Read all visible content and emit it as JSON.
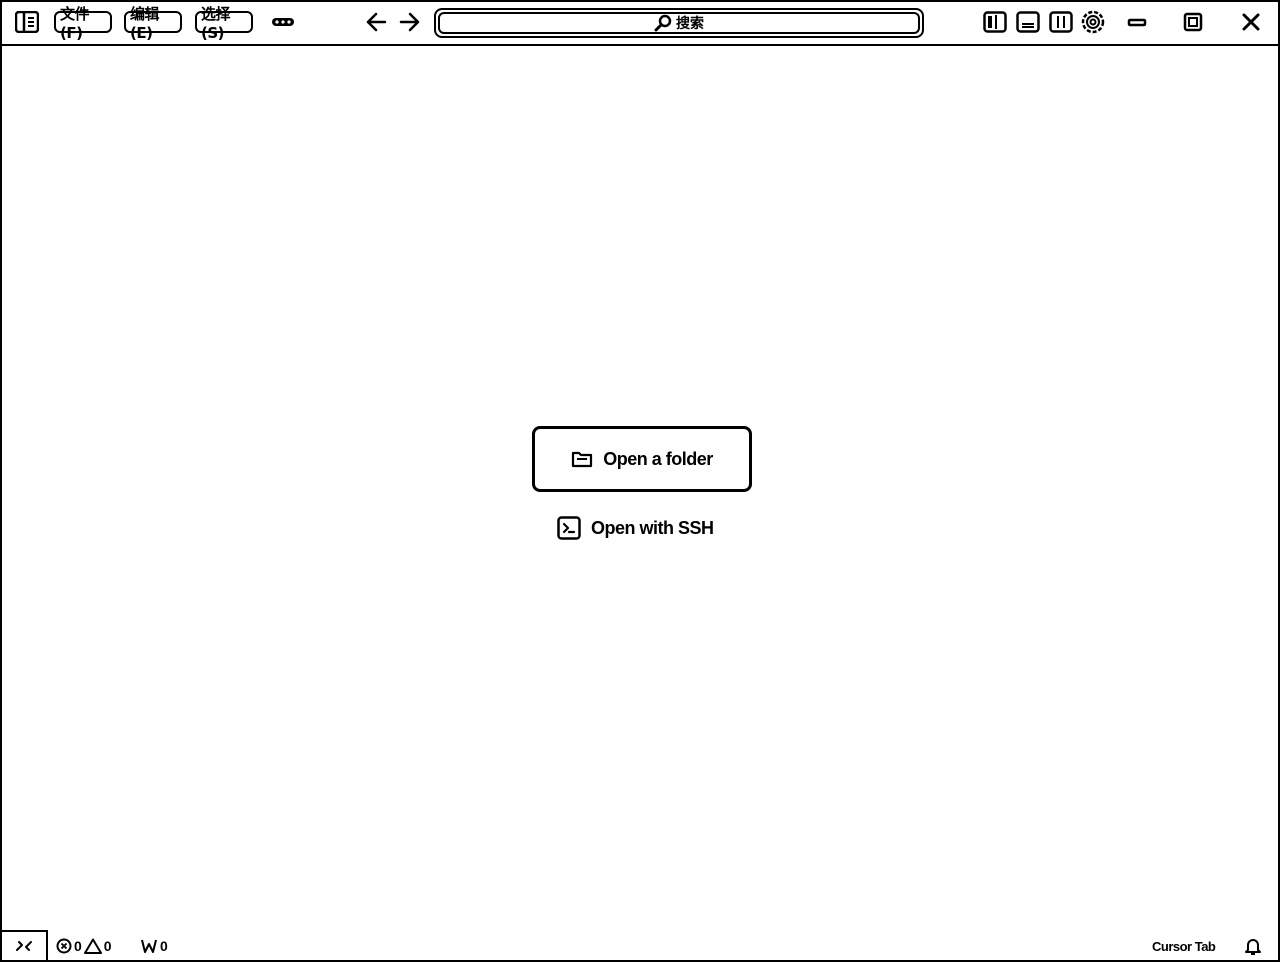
{
  "titlebar": {
    "menus": [
      {
        "label": "文件(F)"
      },
      {
        "label": "编辑(E)"
      },
      {
        "label": "选择(S)"
      }
    ],
    "more_label": "•••",
    "search_placeholder": "搜索"
  },
  "main": {
    "open_folder_label": "Open a folder",
    "open_ssh_label": "Open with SSH"
  },
  "statusbar": {
    "errors": "0",
    "warnings": "0",
    "ports": "0",
    "cursor_tab_label": "Cursor Tab"
  }
}
